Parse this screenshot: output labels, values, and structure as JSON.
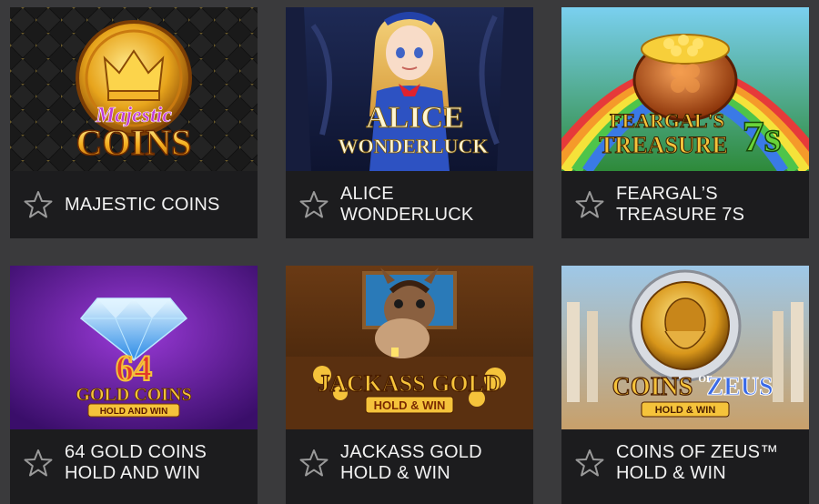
{
  "games": [
    {
      "title": "MAJESTIC COINS",
      "logo_line1": "Majestic",
      "logo_line2": "COINS",
      "favorite_icon": "star-outline-icon"
    },
    {
      "title": "ALICE\nWONDERLUCK",
      "logo_line1": "ALICE",
      "logo_line2": "WONDERLUCK",
      "favorite_icon": "star-outline-icon"
    },
    {
      "title": "FEARGAL’S\nTREASURE 7S",
      "logo_line1": "FEARGAL'S",
      "logo_line2": "TREASURE",
      "logo_badge": "7s",
      "favorite_icon": "star-outline-icon"
    },
    {
      "title": "64 GOLD COINS\nHOLD AND WIN",
      "logo_line1": "64",
      "logo_line2": "GOLD COINS",
      "logo_line3": "HOLD AND WIN",
      "favorite_icon": "star-outline-icon"
    },
    {
      "title": "JACKASS GOLD\nHOLD & WIN",
      "logo_line1": "JACKASS GOLD",
      "logo_line2": "HOLD & WIN",
      "favorite_icon": "star-outline-icon"
    },
    {
      "title": "COINS OF ZEUS™\nHOLD & WIN",
      "logo_line1": "COINS",
      "logo_of": "OF",
      "logo_line2": "ZEUS",
      "logo_line3": "HOLD & WIN",
      "favorite_icon": "star-outline-icon"
    }
  ],
  "colors": {
    "page_bg": "#3a3a3c",
    "card_footer_bg": "#1c1c1e",
    "title_text": "#f2f2f2",
    "star_outline": "#9a9a9a",
    "gold": "#f5c33b"
  }
}
